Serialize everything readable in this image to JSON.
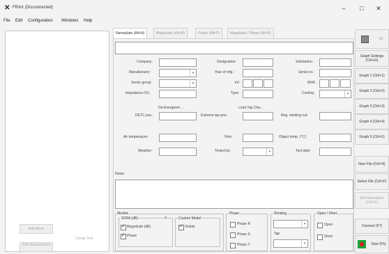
{
  "window": {
    "title": "FRAX (Disconnected)",
    "minimize": "–",
    "maximize": "□",
    "close": "✕"
  },
  "menu": [
    "File",
    "Edit",
    "Configuration",
    "Windows",
    "Help"
  ],
  "left_panel": {
    "add_meas": "Add Meas",
    "create_test": "Create Test",
    "edit_meas": "Edit Measurement"
  },
  "tabs": [
    "Nameplate (Alt+N)",
    "Magnitude (Alt+M)",
    "Phase (Alt+P)",
    "Magnitude / Phase (Alt+B)"
  ],
  "nameplate": {
    "company": "Company:",
    "designation": "Designation:",
    "substation": "Substation:",
    "manufacturer": "Manufacturer:",
    "year": "Year of mfg.:",
    "serial": "Serial no.:",
    "vector": "Vector group:",
    "kv": "kV:",
    "mva": "MVA:",
    "impedance": "Impedance (%):",
    "type": "Type:",
    "cooling": "Cooling:",
    "de_energized": "De-Energized ...",
    "load_tap": "Load Tap Cha...",
    "detc_pos": "DETC pos.:",
    "extreme_tap": "Extreme tap pos.:",
    "reg_winding": "Reg. winding out:",
    "air_temp": "Air temperature:",
    "ho": "%ho:",
    "object_temp": "Object temp. (°C):",
    "weather": "Weather:",
    "tested_by": "Tested by:",
    "test_date": "Test date:",
    "notes": "Notes"
  },
  "bottom": {
    "models": "Models",
    "sfra": "SFRA (dB)",
    "sfra_mag": "Magnitude (dB)",
    "sfra_phase": "Phase",
    "custom_model": "Custom Model",
    "visible": "Visible",
    "phase_group": "Phase",
    "phase_r": "Phase R",
    "phase_s": "Phase S",
    "phase_t": "Phase T",
    "winding": "Winding",
    "tap": "Tap",
    "open_short": "Open / Short",
    "open": "Open",
    "short": "Short"
  },
  "right_panel": {
    "top_btn": "Alt",
    "graph_settings": "Graph Settings (Ctrl+G)",
    "graph1": "Graph 1 (Ctrl+1)",
    "graph2": "Graph 2 (Ctrl+2)",
    "graph3": "Graph 3 (Ctrl+3)",
    "graph4": "Graph 4 (Ctrl+4)",
    "graph5": "Graph 5 (Ctrl+5)",
    "new_file": "New File (Ctrl+N)",
    "select_file": "Select File (Ctrl+F)",
    "edit_nameplate": "Edit Nameplate (Ctrl+E)",
    "connect": "Connect (F7)",
    "start": "Start (F5)"
  }
}
